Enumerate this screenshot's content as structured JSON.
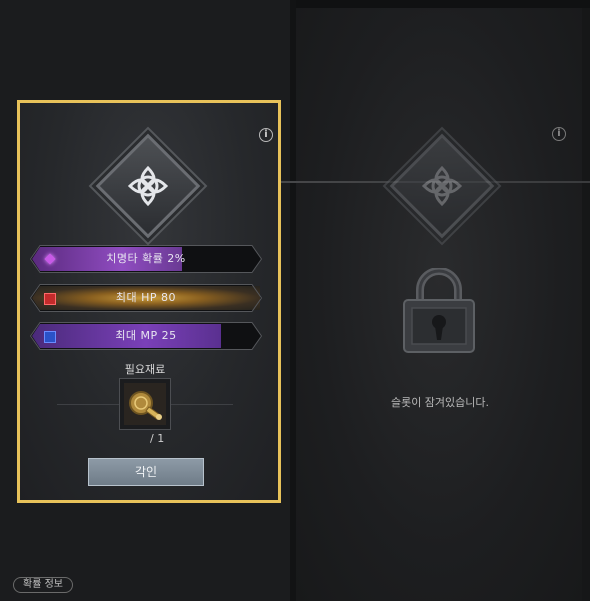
{
  "slot_active": {
    "stats": [
      {
        "label": "치명타 확률 2%",
        "gem": "purple-diamond-gem",
        "fill": 0.66
      },
      {
        "label": "최대 HP 80",
        "gem": "red-square-gem",
        "fill": 1.0
      },
      {
        "label": "최대 MP 25",
        "gem": "blue-square-gem",
        "fill": 0.83
      }
    ],
    "material_title": "필요재료",
    "material_count": "/ 1",
    "material_icon": "seal-stamp-icon",
    "action_label": "각인",
    "highlight_color": "#e8c25a"
  },
  "slot_locked": {
    "lock_text": "슬롯이 잠겨있습니다."
  },
  "footer": {
    "probability_label": "확률 정보"
  },
  "icons": {
    "info": "i"
  }
}
